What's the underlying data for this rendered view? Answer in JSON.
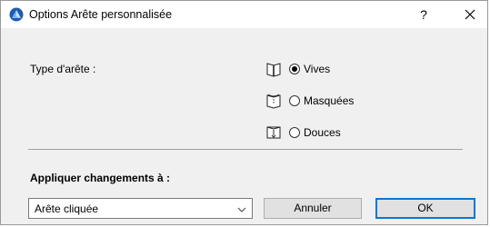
{
  "window": {
    "title": "Options Arête personnalisée",
    "help_label": "?",
    "icons": {
      "app": "archicad-app-icon",
      "close": "close-icon"
    }
  },
  "edge_type": {
    "label": "Type d'arête :",
    "options": [
      {
        "label": "Vives",
        "icon": "sharp-edge-icon",
        "selected": true
      },
      {
        "label": "Masquées",
        "icon": "hidden-edge-icon",
        "selected": false
      },
      {
        "label": "Douces",
        "icon": "smooth-edge-icon",
        "selected": false
      }
    ]
  },
  "apply": {
    "label": "Appliquer changements à :",
    "selected_value": "Arête cliquée"
  },
  "buttons": {
    "cancel_label": "Annuler",
    "ok_label": "OK"
  },
  "colors": {
    "app_icon": "#1e5bb0",
    "default_button_border": "#0078d7",
    "dialog_background": "#f0f0f0"
  }
}
